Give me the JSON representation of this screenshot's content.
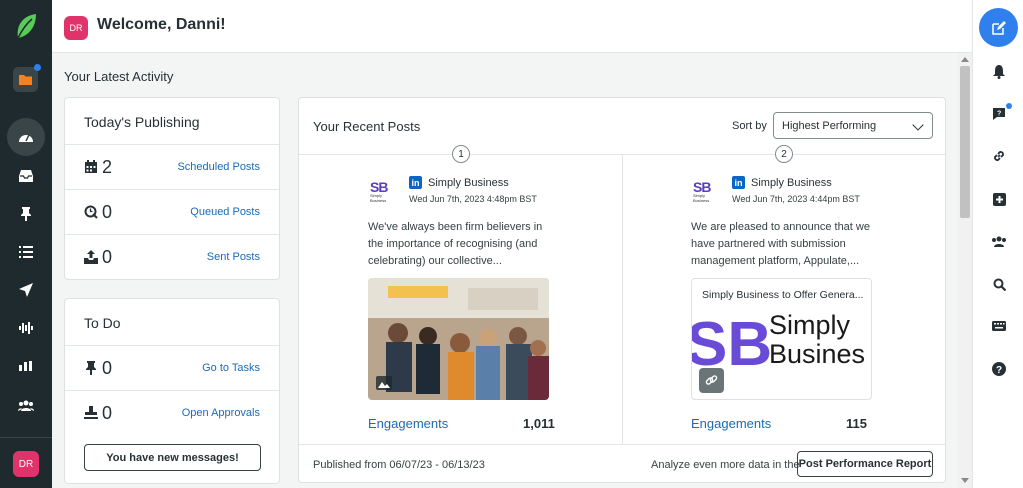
{
  "header": {
    "avatar_initials": "DR",
    "welcome": "Welcome, Danni!"
  },
  "left_nav": {
    "avatar_initials": "DR"
  },
  "section_title": "Your Latest Activity",
  "publishing": {
    "title": "Today's Publishing",
    "rows": [
      {
        "icon": "calendar-icon",
        "count": "2",
        "link": "Scheduled Posts"
      },
      {
        "icon": "queue-icon",
        "count": "0",
        "link": "Queued Posts"
      },
      {
        "icon": "sent-icon",
        "count": "0",
        "link": "Sent Posts"
      }
    ]
  },
  "todo": {
    "title": "To Do",
    "rows": [
      {
        "icon": "pin-icon",
        "count": "0",
        "link": "Go to Tasks"
      },
      {
        "icon": "approval-icon",
        "count": "0",
        "link": "Open Approvals"
      }
    ],
    "messages_button": "You have new messages!"
  },
  "recent_posts": {
    "title": "Your Recent Posts",
    "sort_label": "Sort by",
    "sort_value": "Highest Performing",
    "posts": [
      {
        "rank": "1",
        "logo_text": "SB",
        "logo_sub": "Simply Business",
        "account": "Simply Business",
        "date": "Wed Jun 7th, 2023 4:48pm BST",
        "body": "We've always been firm believers in the importance of recognising (and celebrating) our collective...",
        "engagement_label": "Engagements",
        "engagement_value": "1,011"
      },
      {
        "rank": "2",
        "logo_text": "SB",
        "logo_sub": "Simply Business",
        "account": "Simply Business",
        "date": "Wed Jun 7th, 2023 4:44pm BST",
        "body": "We are pleased to announce that we have partnered with submission management platform, Appulate,...",
        "link_title": "Simply Business to Offer Genera...",
        "link_brand_line1": "Simply",
        "link_brand_line2": "Busines",
        "engagement_label": "Engagements",
        "engagement_value": "115"
      }
    ],
    "footer_left": "Published from 06/07/23 - 06/13/23",
    "footer_right": "Analyze even more data in the",
    "report_button": "Post Performance Report"
  },
  "colors": {
    "accent": "#2f80ed",
    "nav_bg": "#1f2a2e",
    "avatar": "#e0336b",
    "link": "#1a6bb8",
    "brand_purple": "#5b3fb5",
    "linkedin": "#0a66c2"
  }
}
